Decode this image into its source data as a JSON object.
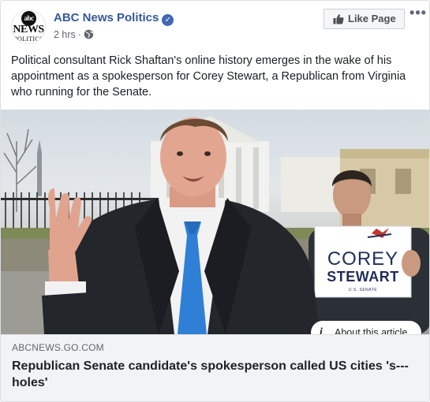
{
  "header": {
    "page_name": "ABC News Politics",
    "verified_icon": "verified-check-icon",
    "timestamp": "2 hrs",
    "separator": "·",
    "audience_icon": "globe-icon",
    "avatar": {
      "globe_text": "abc",
      "word": "NEWS",
      "sub": "POLITICS"
    },
    "like_button_label": "Like Page",
    "like_button_icon": "thumbs-up-icon",
    "more_button_label": "•••"
  },
  "post": {
    "text": "Political consultant Rick Shaftan's online history emerges in the wake of his appointment as a spokesperson for Corey Stewart, a Republican from Virginia who running for the Senate."
  },
  "photo": {
    "sign_line1": "COREY",
    "sign_line2": "STEWART",
    "sign_line3": "U.S. SENATE",
    "about_article_label": "About this article",
    "about_article_icon": "info-icon"
  },
  "link_preview": {
    "domain": "ABCNEWS.GO.COM",
    "headline": "Republican Senate candidate's spokesperson called US cities 's---holes'"
  },
  "colors": {
    "link_blue": "#365899",
    "verified_blue": "#4267b2",
    "tie_blue": "#2f7fd6",
    "sign_navy": "#1f2d5a"
  }
}
